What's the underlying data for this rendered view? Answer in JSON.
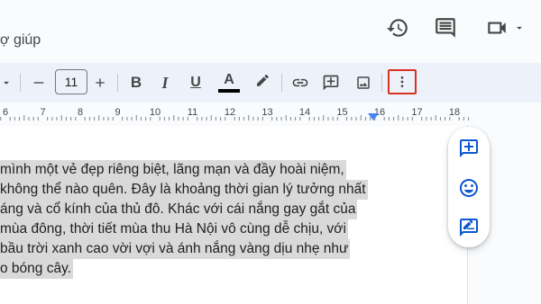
{
  "header": {
    "menu_help_label": "ợ giúp",
    "icons": [
      "version-history-icon",
      "comments-icon",
      "meet-video-icon",
      "dropdown-arrow-icon"
    ]
  },
  "toolbar": {
    "font_size_value": "11",
    "bold_label": "B",
    "italic_label": "I",
    "underline_label": "U",
    "text_color_label": "A",
    "text_color": "#000000",
    "more_options_highlight_color": "#d93025"
  },
  "ruler": {
    "numbers": [
      "6",
      "7",
      "8",
      "9",
      "10",
      "11",
      "12",
      "13",
      "14",
      "15",
      "16",
      "17",
      "18"
    ]
  },
  "document": {
    "lines": [
      "mình một vẻ đẹp riêng biệt, lãng mạn và đầy hoài niệm,",
      "không thể nào quên. Đây là khoảng thời gian lý tưởng nhất",
      "áng và cổ kính của thủ đô. Khác với cái nắng gay gắt của",
      "mùa đông, thời tiết mùa thu Hà Nội vô cùng dễ chịu, với",
      "bầu trời xanh cao vời vợi và ánh nắng vàng dịu nhẹ như",
      "o bóng cây."
    ]
  },
  "side_panel": {
    "buttons": [
      "add-comment-icon",
      "emoji-reaction-icon",
      "suggest-edits-icon"
    ],
    "accent": "#0b57d0"
  }
}
